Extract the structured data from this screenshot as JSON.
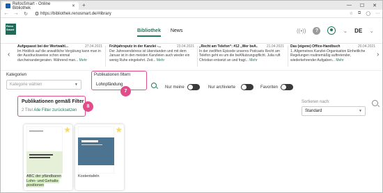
{
  "browser": {
    "tab_title": "RefosSmart - Online Bibliothek",
    "tab_close": "✕",
    "new_tab": "+",
    "url": "https://bibliothek.renosmart.de/#library",
    "win_min": "—",
    "win_max": "☐",
    "win_close": "✕"
  },
  "app": {
    "logo_text": "Reno Smart",
    "nav": [
      {
        "label": "Bibliothek",
        "active": true
      },
      {
        "label": "News",
        "active": false
      }
    ],
    "help": "?",
    "language": "DE",
    "chevron": "⌄"
  },
  "news": {
    "prev": "‹",
    "next": "›",
    "mehr": "Mehr",
    "items": [
      {
        "title": "Aufgepasst bei der Wortwahl...",
        "date": "27.04.2021",
        "text": "Im Hinblick auf die anwaltliche Vergütung kann man in der Ausdrucksweise schon einmal durcheinandergeraten. Während man..."
      },
      {
        "title": "Frühjahrsputz in der Kanzlei -...",
        "date": "23.04.2021",
        "text": "Der Jahresendstress ist überstanden und mit dem Januar ist in den meisten Kanzleien auch wieder ein wenig Ruhe eingekehrt. Zeit..."
      },
      {
        "title": "„Recht am Telefon“: #12 „Wer beA...",
        "date": "21.04.2021",
        "text": "In der zwölften Episode unseres Podcasts Recht am Telefon geht es um die beANutzungspflicht. Julia ruft Christian entsetzt an und fragt..."
      },
      {
        "title": "Das (eigene) Office-Handbuch",
        "date": "20.04.2021",
        "text": "1. Allgemeines Kanzlei-Organisation Einheitliche Regelungen routinemäßig auftretender, wiederkehrender Aufgaben..."
      }
    ]
  },
  "filters": {
    "categories_label": "Kategorien",
    "categories_placeholder": "Kategorie wählen",
    "publications_label": "Publikationen filtern",
    "publications_value": "Lohnpfändung",
    "toggles": [
      {
        "label": "Nur meine",
        "on": false
      },
      {
        "label": "Nur archivierte",
        "on": false
      },
      {
        "label": "Favoriten",
        "on": false
      }
    ],
    "step_badge": "7"
  },
  "results": {
    "title": "Publikationen gemäß Filter",
    "count": "2 Titel",
    "reset": "Alle Filter zurücksetzen",
    "step_badge": "8",
    "sort_label": "Sortieren nach:",
    "sort_value": "Standard",
    "books": [
      {
        "title_lines": [
          "ABC der pfändbaren",
          "Lohn- und Gehalts-",
          "positionen"
        ],
        "cover_heading": "ABC der pfändbaren Lohn- und Gehalts-",
        "cover_color": "#e6f0d9"
      },
      {
        "title_lines": [
          "Kostentafeln"
        ],
        "cover_heading": "Kostentafeln",
        "cover_color": "#4c7390"
      }
    ]
  },
  "colors": {
    "accent": "#1f7b5a",
    "highlight": "#e24c8a"
  }
}
